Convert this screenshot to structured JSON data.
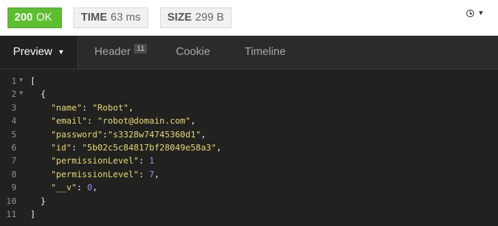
{
  "status": {
    "code": "200",
    "text": "OK",
    "color": "#5bbf2f"
  },
  "time": {
    "label": "TIME",
    "value": "63 ms"
  },
  "size": {
    "label": "SIZE",
    "value": "299 B"
  },
  "history_icon": "clock-icon",
  "tabs": {
    "preview": "Preview",
    "header": "Header",
    "header_count": "11",
    "cookie": "Cookie",
    "timeline": "Timeline"
  },
  "response": {
    "line_numbers": [
      "1",
      "2",
      "3",
      "4",
      "5",
      "6",
      "7",
      "8",
      "9",
      "10",
      "11"
    ],
    "open_bracket": "[",
    "open_brace": "{",
    "close_brace": "}",
    "close_bracket": "]",
    "fields": [
      {
        "key": "\"name\"",
        "sep": ": ",
        "value": "\"Robot\"",
        "type": "string",
        "comma": ","
      },
      {
        "key": "\"email\"",
        "sep": ": ",
        "value": "\"robot@domain.com\"",
        "type": "string",
        "comma": ","
      },
      {
        "key": "\"password\"",
        "sep": ":",
        "value": "\"s3328w74745360d1\"",
        "type": "string",
        "comma": ","
      },
      {
        "key": "\"id\"",
        "sep": ": ",
        "value": "\"5b02c5c84817bf28049e58a3\"",
        "type": "string",
        "comma": ","
      },
      {
        "key": "\"permissionLevel\"",
        "sep": ": ",
        "value": "1",
        "type": "number",
        "comma": ""
      },
      {
        "key": "\"permissionLevel\"",
        "sep": ": ",
        "value": "7",
        "type": "number",
        "comma": ","
      },
      {
        "key": "\"__v\"",
        "sep": ": ",
        "value": "0",
        "type": "number",
        "comma": ","
      }
    ]
  }
}
